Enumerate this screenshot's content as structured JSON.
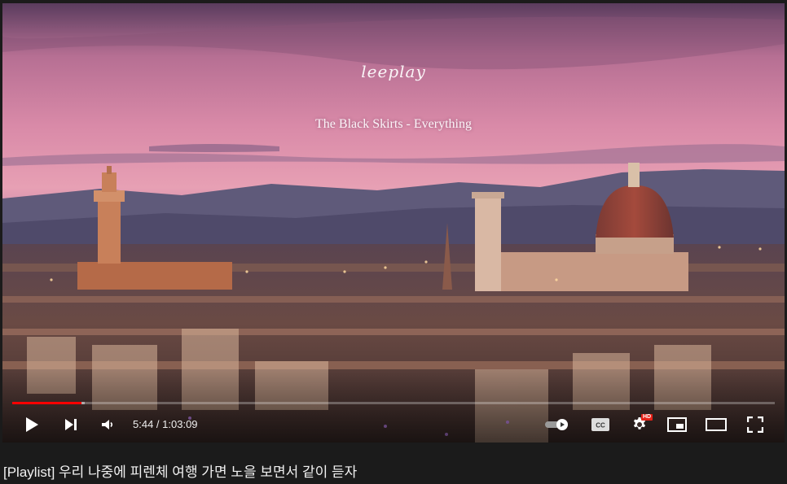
{
  "video": {
    "watermark": "leeplay",
    "caption": "The Black Skirts - Everything"
  },
  "player": {
    "progress_fraction": 0.0905,
    "buffered_fraction": 0.095,
    "time": {
      "current": "5:44",
      "separator": " / ",
      "duration": "1:03:09"
    },
    "settings_badge": "HD",
    "progress_color": "#ff0000",
    "icons": {
      "play": "play-icon",
      "next": "next-icon",
      "volume": "volume-icon",
      "autoplay": "autoplay-toggle-icon",
      "captions": "captions-icon",
      "settings": "settings-gear-icon",
      "miniplayer": "miniplayer-icon",
      "theater": "theater-mode-icon",
      "fullscreen": "fullscreen-icon"
    }
  },
  "title": "[Playlist] 우리 나중에 피렌체 여행 가면 노을 보면서 같이 듣자"
}
